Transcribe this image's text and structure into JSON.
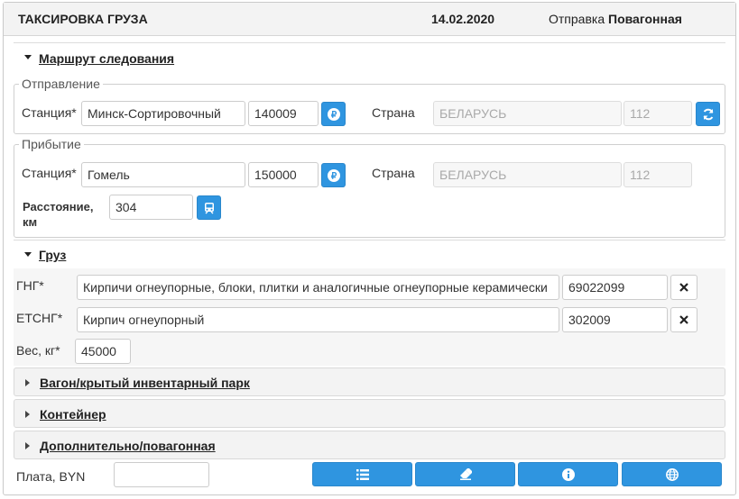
{
  "header": {
    "title": "ТАКСИРОВКА ГРУЗА",
    "date": "14.02.2020",
    "shipment_label": "Отправка",
    "shipment_value": "Повагонная"
  },
  "route": {
    "section_label": "Маршрут следования",
    "departure": {
      "legend": "Отправление",
      "station_label": "Станция*",
      "station_value": "Минск-Сортировочный",
      "station_code": "140009",
      "country_label": "Страна",
      "country_value": "БЕЛАРУСЬ",
      "country_code": "112"
    },
    "arrival": {
      "legend": "Прибытие",
      "station_label": "Станция*",
      "station_value": "Гомель",
      "station_code": "150000",
      "country_label": "Страна",
      "country_value": "БЕЛАРУСЬ",
      "country_code": "112",
      "distance_label_1": "Расстояние,",
      "distance_label_2": "км",
      "distance_value": "304"
    }
  },
  "cargo": {
    "section_label": "Груз",
    "gng_label": "ГНГ*",
    "gng_name": "Кирпичи огнеупорные, блоки, плитки и аналогичные огнеупорные керамически",
    "gng_code": "69022099",
    "etsng_label": "ЕТСНГ*",
    "etsng_name": "Кирпич огнеупорный",
    "etsng_code": "302009",
    "weight_label": "Вес, кг*",
    "weight_value": "45000"
  },
  "collapsed_sections": [
    "Вагон/крытый инвентарный парк",
    "Контейнер",
    "Дополнительно/повагонная"
  ],
  "footer": {
    "fee_label": "Плата, BYN",
    "fee_value": "",
    "buttons": [
      "list-icon",
      "eraser-icon",
      "info-icon",
      "globe-icon"
    ]
  },
  "colors": {
    "accent": "#2f95e0",
    "header_bg": "#f3f3f3"
  }
}
